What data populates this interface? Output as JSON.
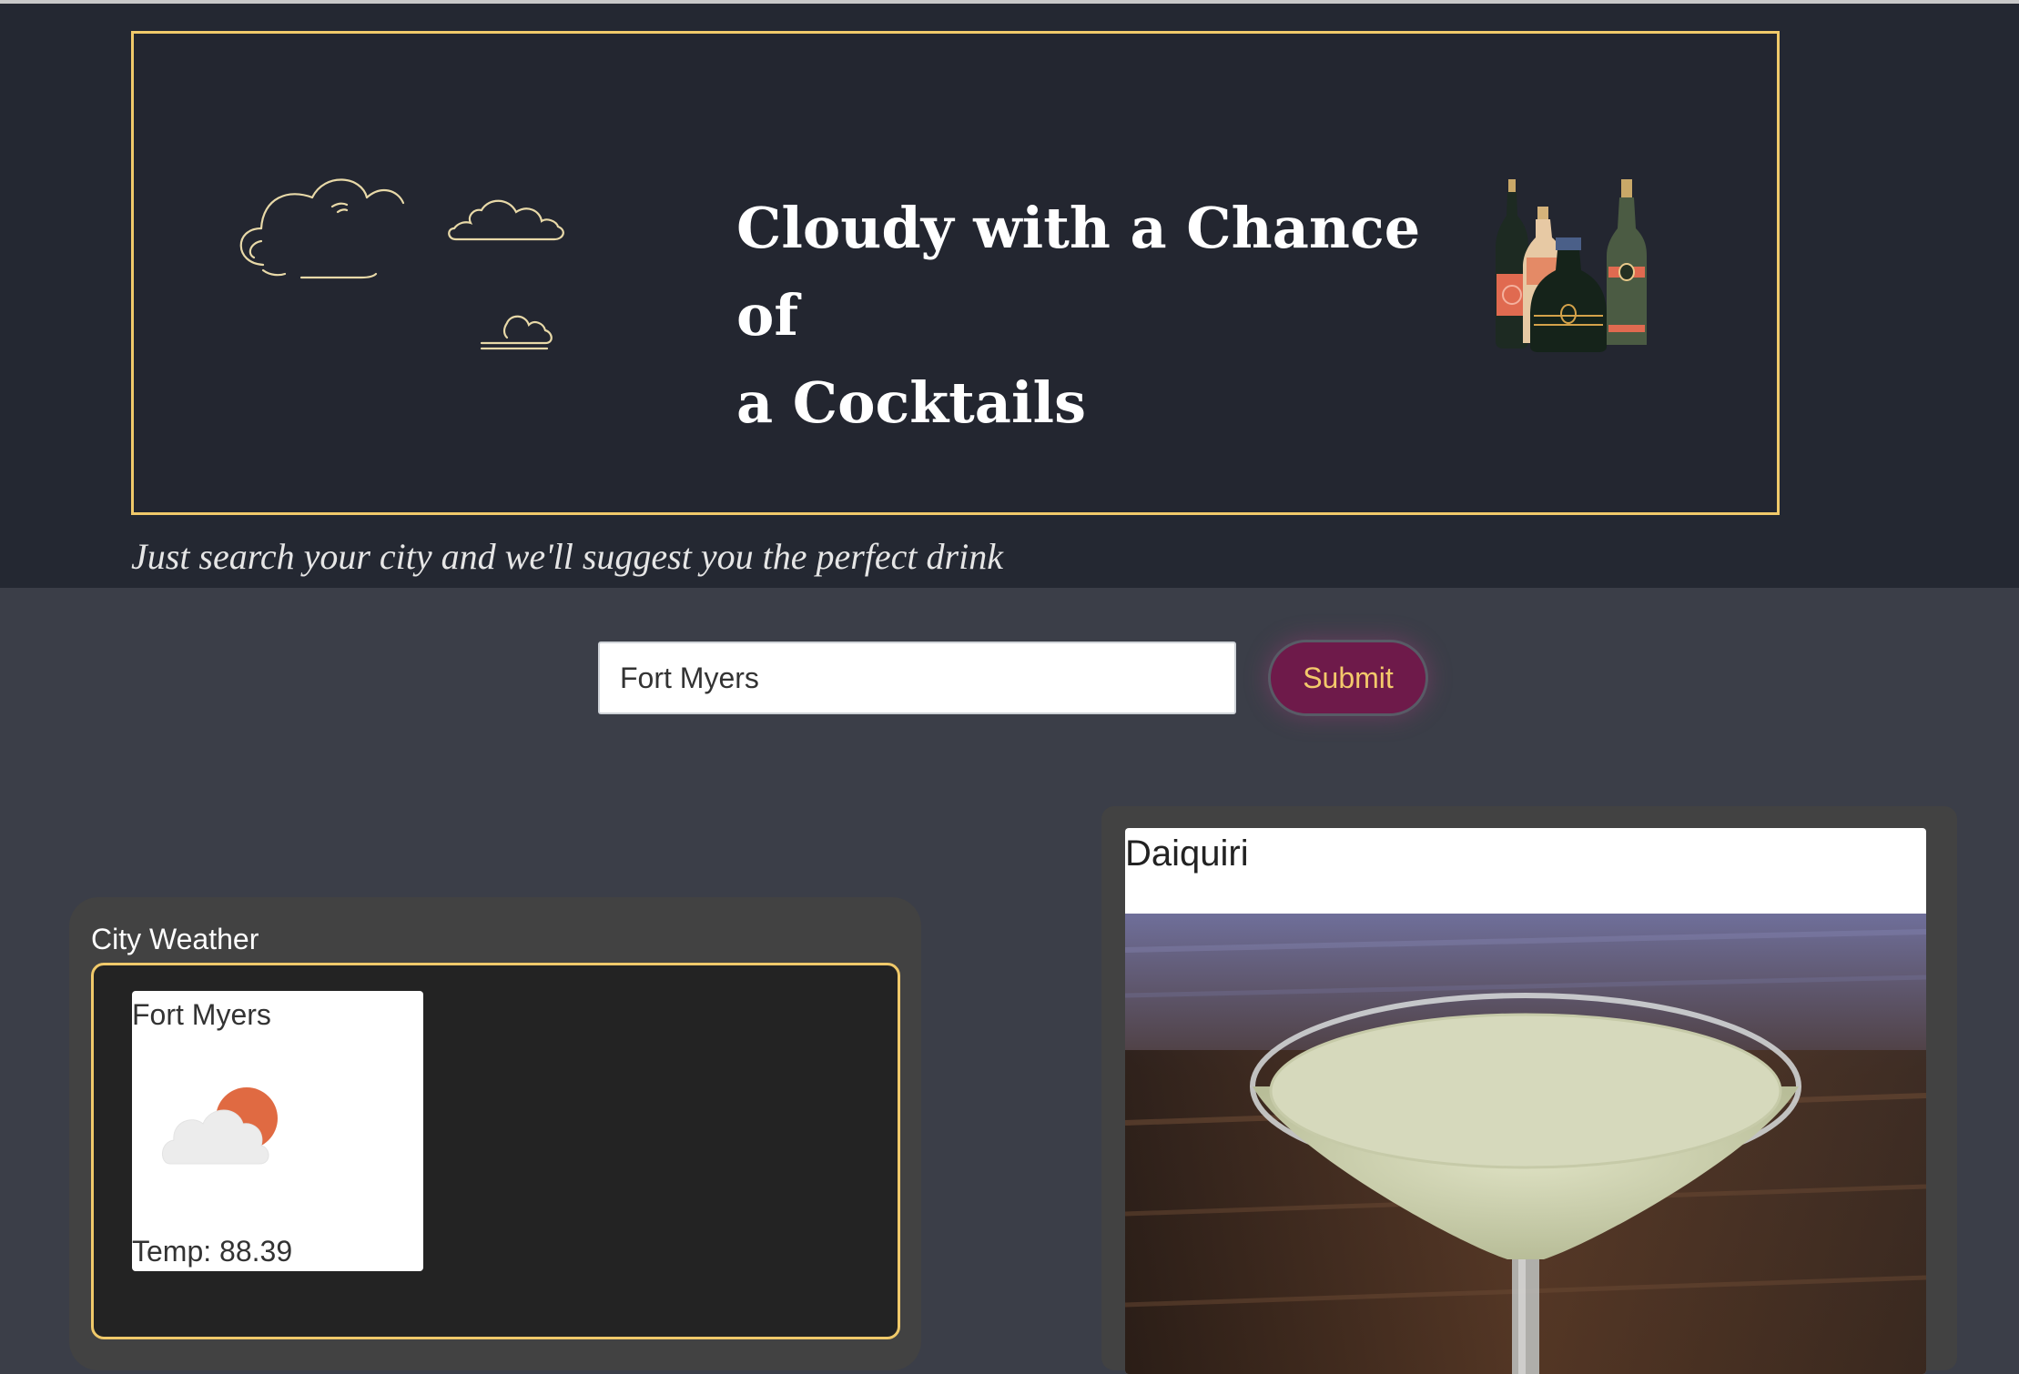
{
  "header": {
    "title_line1": "Cloudy with a Chance of",
    "title_line2": "a Cocktails",
    "tagline": "Just search your city and we'll suggest you the perfect drink",
    "decor_icons": [
      "clouds-illustration",
      "liquor-bottles-illustration"
    ]
  },
  "search": {
    "value": "Fort Myers",
    "placeholder": "",
    "submit_label": "Submit"
  },
  "weather": {
    "heading": "City Weather",
    "card": {
      "city": "Fort Myers",
      "icon": "partly-cloudy-sun-icon",
      "temp_label": "Temp: 88.39"
    }
  },
  "drink": {
    "name": "Daiquiri",
    "image": "daiquiri-cocktail-photo"
  },
  "colors": {
    "header_bg": "#242832",
    "page_bg": "#3b3e48",
    "accent_gold": "#f0c96a",
    "button_bg": "#6e1a4a",
    "panel_bg": "#424242"
  }
}
